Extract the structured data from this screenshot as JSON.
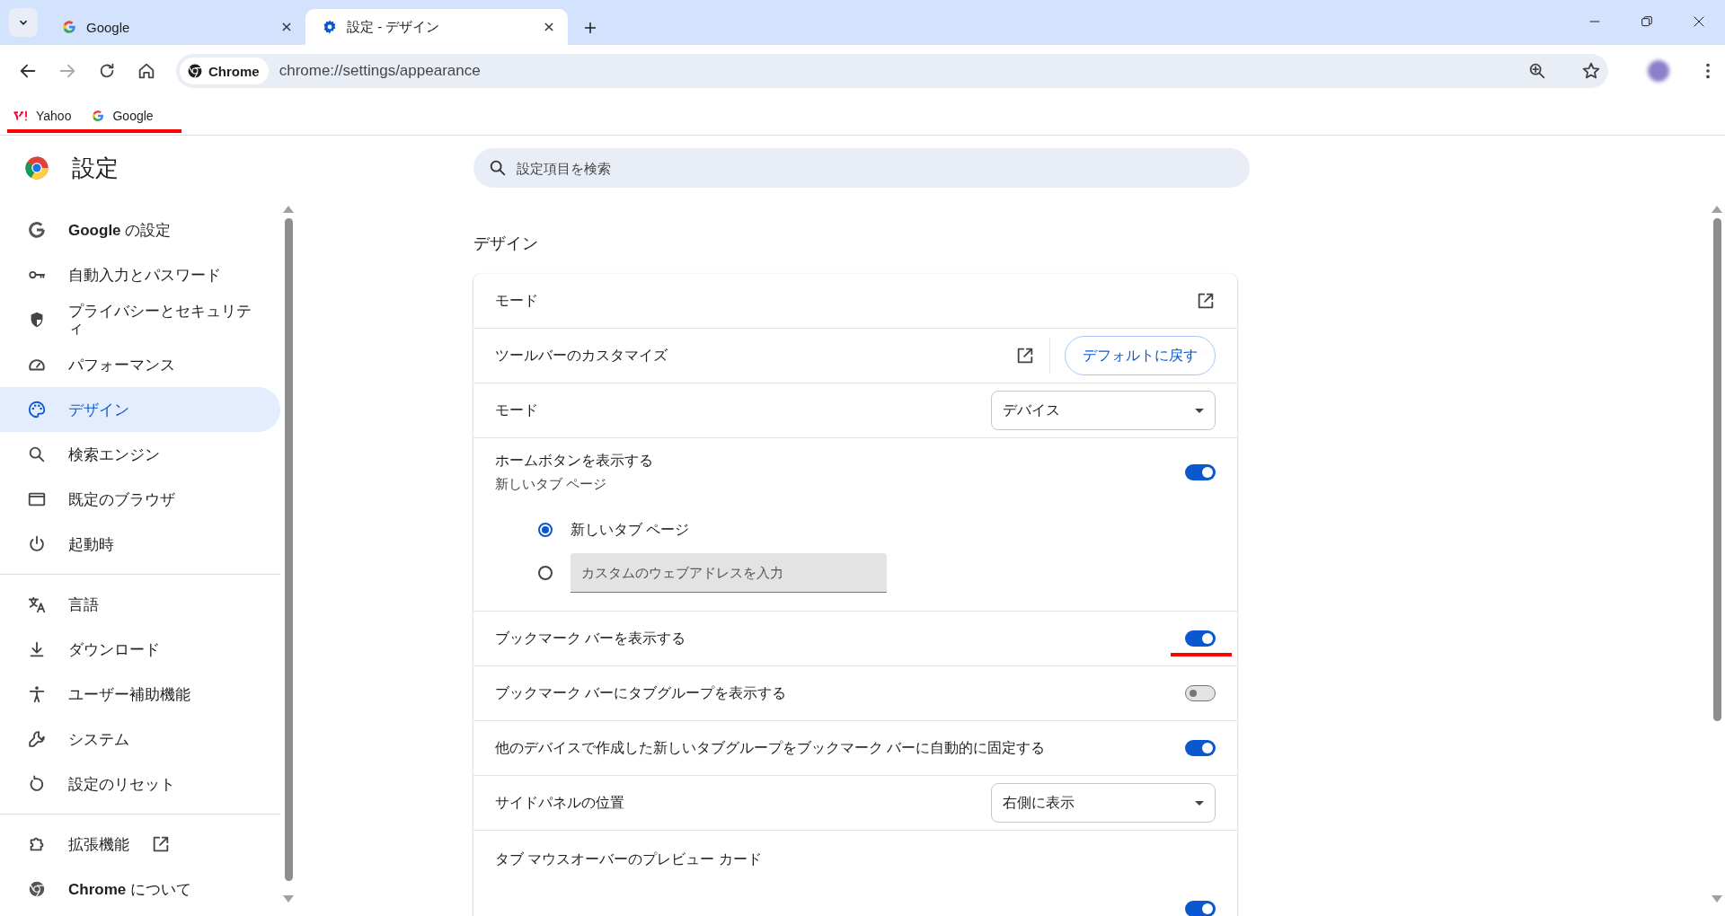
{
  "tabs": [
    {
      "title": "Google",
      "kind": "google",
      "selected": false
    },
    {
      "title": "設定 - デザイン",
      "kind": "settings",
      "selected": true
    }
  ],
  "toolbar": {
    "site_chip": "Chrome",
    "url": "chrome://settings/appearance"
  },
  "bookmarks_bar": {
    "annotated": true,
    "items": [
      {
        "title": "Yahoo",
        "kind": "yahoo"
      },
      {
        "title": "Google",
        "kind": "google"
      }
    ]
  },
  "sidebar": {
    "title": "設定",
    "groups": [
      [
        {
          "label": "**Google** の設定",
          "selected": false
        },
        {
          "label": "自動入力とパスワード",
          "selected": false
        },
        {
          "label": "プライバシーとセキュリティ",
          "selected": false
        },
        {
          "label": "パフォーマンス",
          "selected": false
        },
        {
          "label": "デザイン",
          "selected": true
        },
        {
          "label": "検索エンジン",
          "selected": false
        },
        {
          "label": "既定のブラウザ",
          "selected": false
        },
        {
          "label": "起動時",
          "selected": false
        }
      ],
      [
        {
          "label": "言語",
          "selected": false
        },
        {
          "label": "ダウンロード",
          "selected": false
        },
        {
          "label": "ユーザー補助機能",
          "selected": false
        },
        {
          "label": "システム",
          "selected": false
        },
        {
          "label": "設定のリセット",
          "selected": false
        }
      ],
      [
        {
          "label": "拡張機能",
          "kind": "external",
          "selected": false
        },
        {
          "label": "**Chrome** について",
          "selected": false
        }
      ]
    ]
  },
  "search": {
    "placeholder": "設定項目を検索"
  },
  "section": {
    "title": "デザイン",
    "rows": [
      {
        "kind": "link",
        "label": "モード"
      },
      {
        "kind": "link_button",
        "label": "ツールバーのカスタマイズ",
        "button": "デフォルトに戻す"
      },
      {
        "kind": "select",
        "label": "モード",
        "value": "デバイス"
      },
      {
        "kind": "toggle",
        "label": "ホームボタンを表示する",
        "sublabel": "新しいタブ ページ",
        "on": true,
        "options": [
          {
            "kind": "radio",
            "label": "新しいタブ ページ",
            "selected": true
          },
          {
            "kind": "input",
            "placeholder": "カスタムのウェブアドレスを入力",
            "selected": false
          }
        ]
      },
      {
        "kind": "toggle",
        "label": "ブックマーク バーを表示する",
        "on": true,
        "annotated": true
      },
      {
        "kind": "toggle",
        "label": "ブックマーク バーにタブグループを表示する",
        "on": false
      },
      {
        "kind": "toggle",
        "label": "他のデバイスで作成した新しいタブグループをブックマーク バーに自動的に固定する",
        "on": true
      },
      {
        "kind": "select",
        "label": "サイドパネルの位置",
        "value": "右側に表示"
      },
      {
        "kind": "heading",
        "label": "タブ マウスオーバーのプレビュー カード"
      },
      {
        "kind": "toggle",
        "on": true
      }
    ]
  }
}
